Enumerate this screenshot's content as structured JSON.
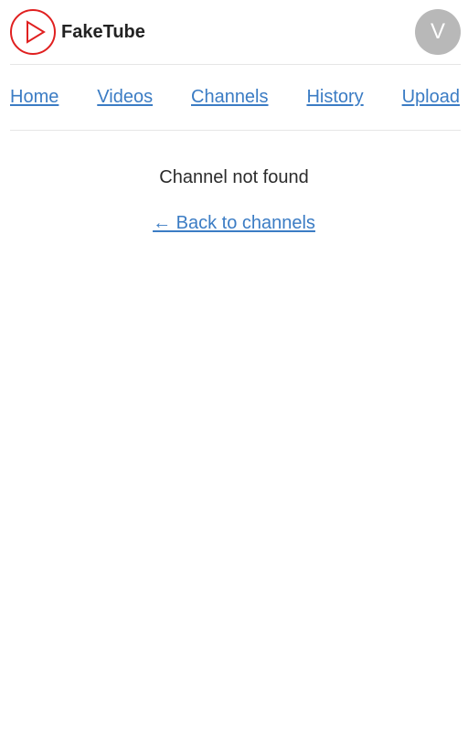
{
  "app": {
    "brand_name": "FakeTube",
    "avatar_initial": "V",
    "colors": {
      "logo_red": "#e02020",
      "link_blue": "#3b7cc4",
      "avatar_gray": "#b8b8b8",
      "text_dark": "#2b2b2b"
    },
    "icons": {
      "logo": "play-circle-icon"
    }
  },
  "nav": {
    "items": [
      {
        "label": "Home"
      },
      {
        "label": "Videos"
      },
      {
        "label": "Channels"
      },
      {
        "label": "History"
      },
      {
        "label": "Upload"
      }
    ]
  },
  "main": {
    "message": "Channel not found",
    "back_link": "← Back to channels"
  }
}
